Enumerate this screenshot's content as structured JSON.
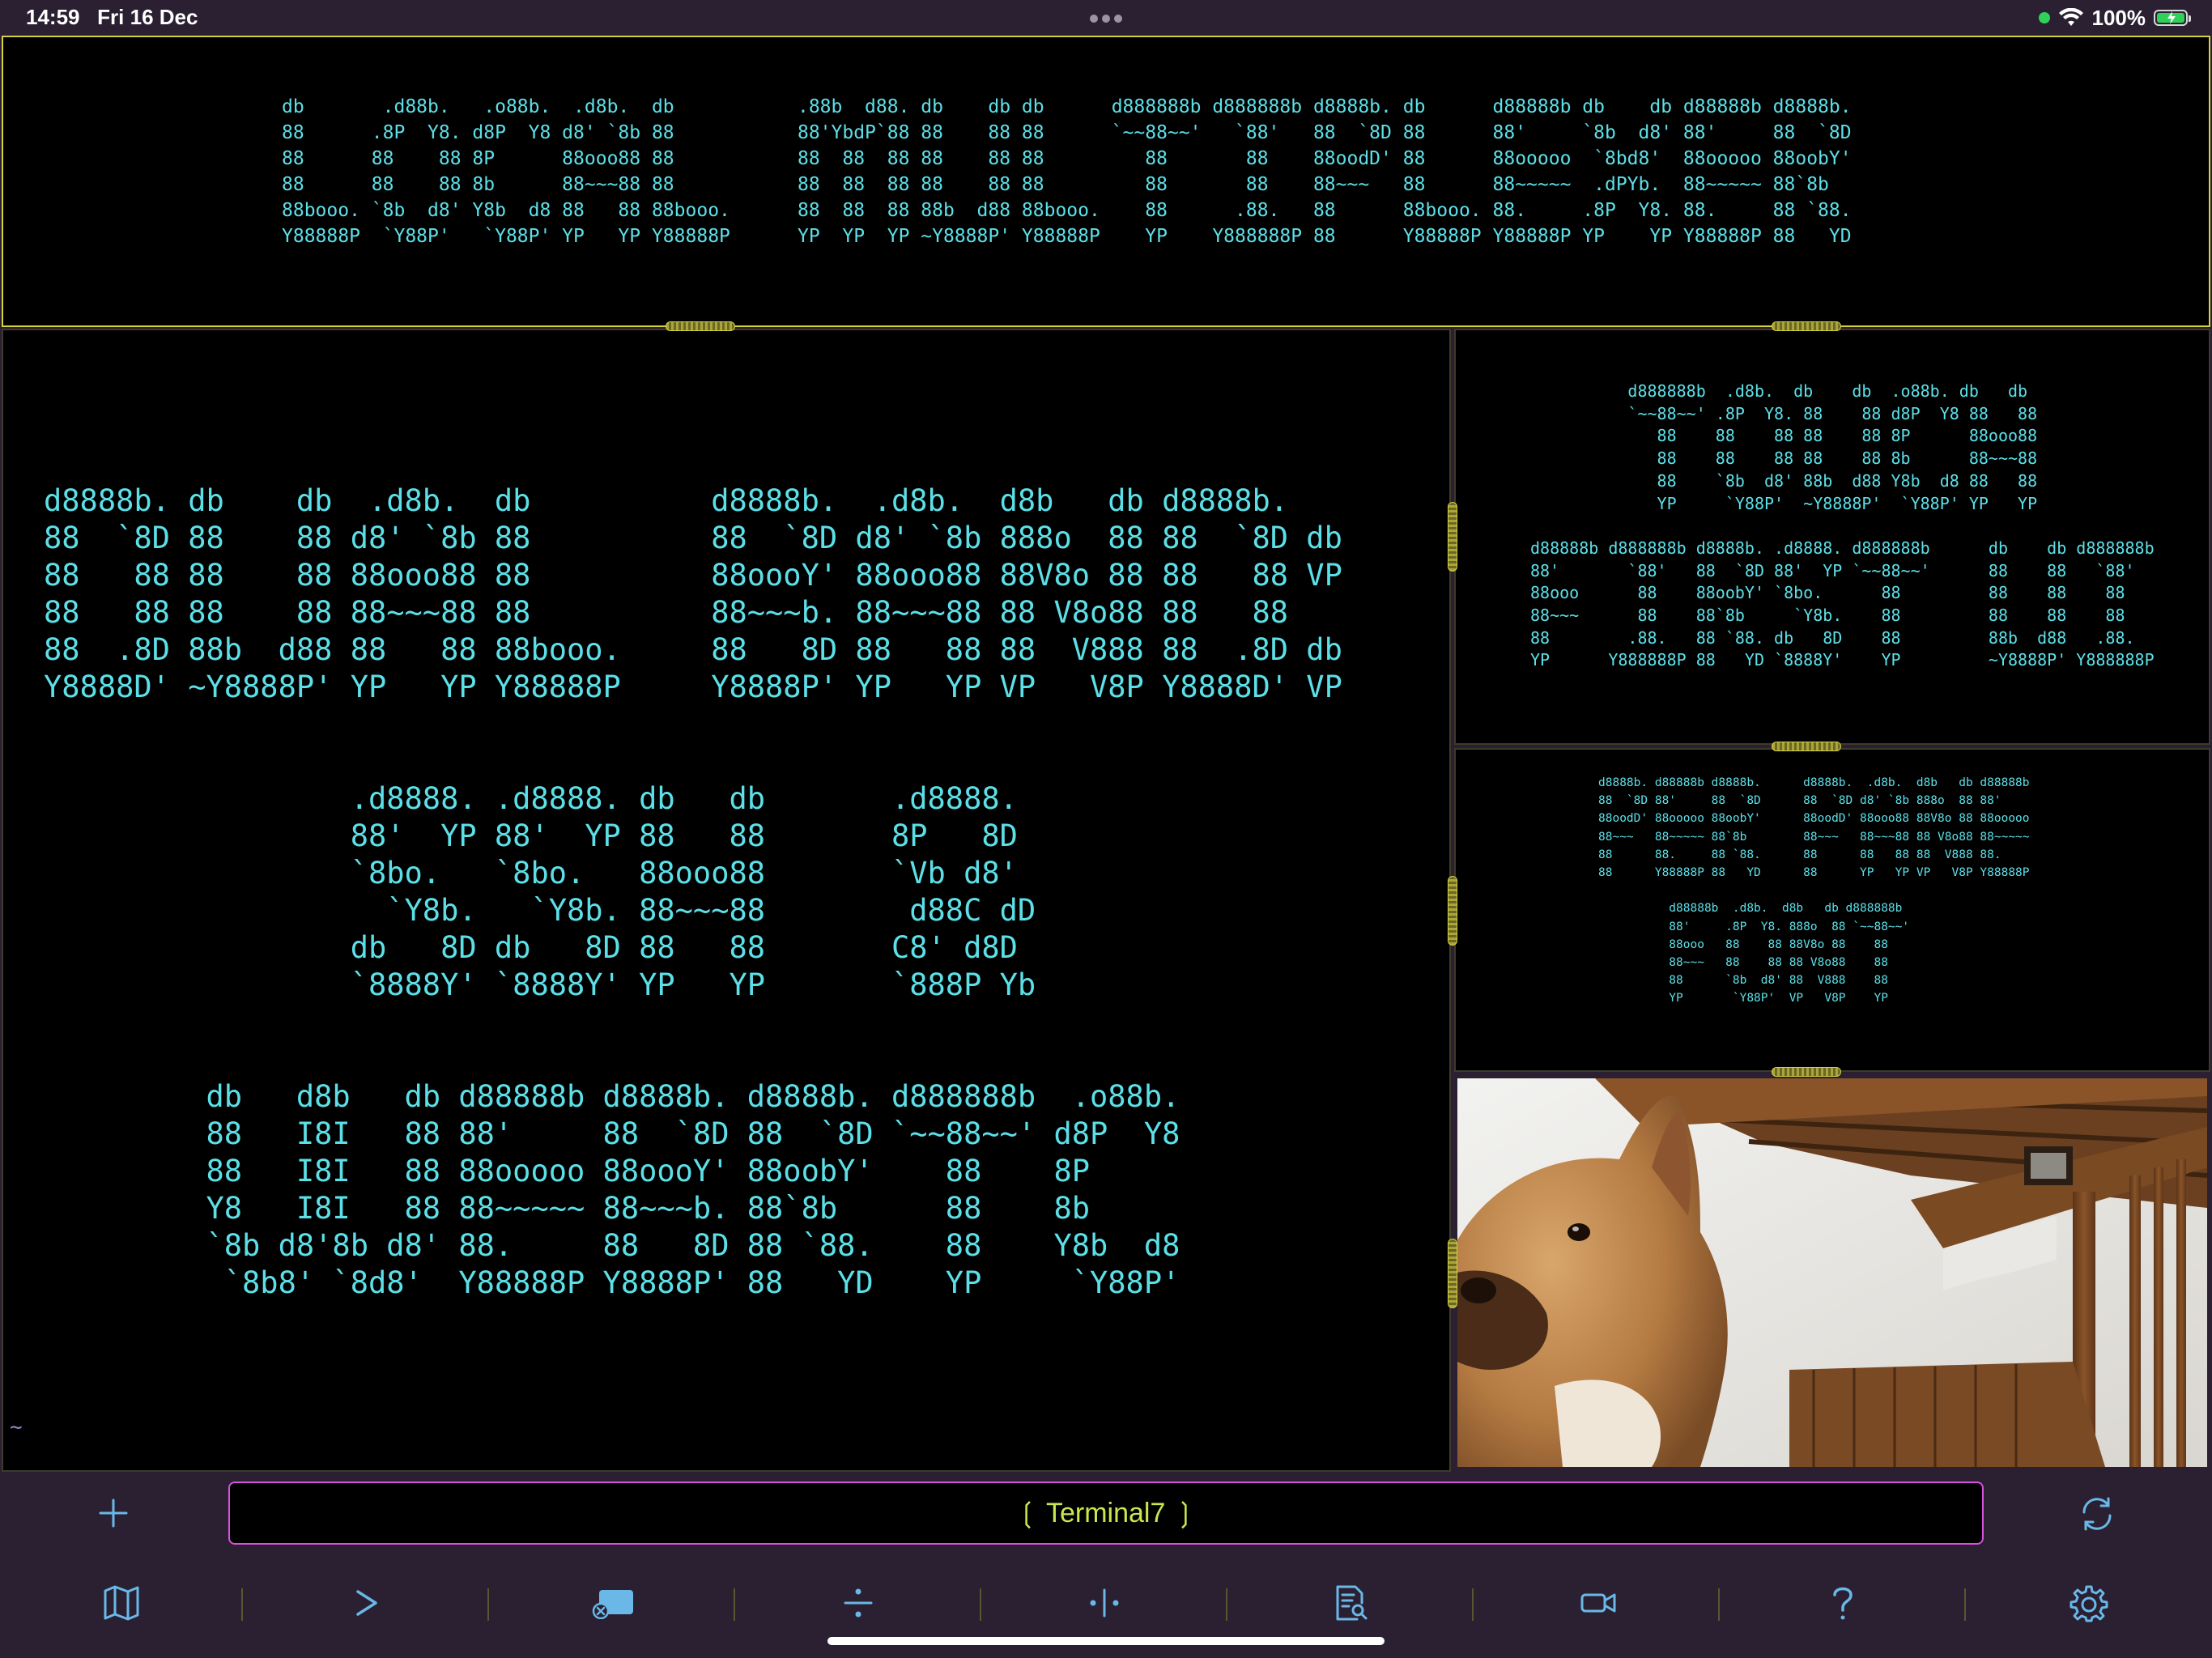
{
  "status_bar": {
    "time": "14:59",
    "date": "Fri 16 Dec",
    "battery_percent": "100%",
    "icons": [
      "green-dot-indicator",
      "wifi-icon",
      "battery-charging-icon"
    ]
  },
  "panes": {
    "top": {
      "ascii": "db       .d88b.   .o88b.  .d8b.  db           .88b  d88. db    db db      d888888b d888888b d8888b. db      d88888b db    db d88888b d8888b.\n88      .8P  Y8. d8P  Y8 d8' `8b 88           88'YbdP`88 88    88 88      `~~88~~'   `88'   88  `8D 88      88'     `8b  d8' 88'     88  `8D\n88      88    88 8P      88ooo88 88           88  88  88 88    88 88         88       88    88oodD' 88      88ooooo  `8bd8'  88ooooo 88oobY'\n88      88    88 8b      88~~~88 88           88  88  88 88    88 88         88       88    88~~~   88      88~~~~~  .dPYb.  88~~~~~ 88`8b\n88booo. `8b  d8' Y8b  d8 88   88 88booo.      88  88  88 88b  d88 88booo.    88      .88.   88      88booo. 88.     .8P  Y8. 88.     88 `88.\nY88888P  `Y88P'   `Y88P' YP   YP Y88888P      YP  YP  YP ~Y8888P' Y88888P    YP    Y888888P 88      Y88888P Y88888P YP    YP Y88888P 88   YD"
    },
    "main": {
      "ascii": "d8888b. db    db  .d8b.  db          d8888b.  .d8b.  d8b   db d8888b.\n88  `8D 88    88 d8' `8b 88          88  `8D d8' `8b 888o  88 88  `8D db\n88   88 88    88 88ooo88 88          88oooY' 88ooo88 88V8o 88 88   88 VP\n88   88 88    88 88~~~88 88          88~~~b. 88~~~88 88 V8o88 88   88\n88  .8D 88b  d88 88   88 88booo.     88   8D 88   88 88  V888 88  .8D db\nY8888D' ~Y8888P' YP   YP Y88888P     Y8888P' YP   YP VP   V8P Y8888D' VP\n\n\n                 .d8888. .d8888. db   db       .d8888.\n                 88'  YP 88'  YP 88   88       8P   8D\n                 `8bo.   `8bo.   88ooo88       `Vb d8'\n                   `Y8b.   `Y8b. 88~~~88        d88C dD\n                 db   8D db   8D 88   88       C8' d8D\n                 `8888Y' `8888Y' YP   YP       `888P Yb\n\n\n         db   d8b   db d88888b d8888b. d8888b. d888888b  .o88b.\n         88   I8I   88 88'     88  `8D 88  `8D `~~88~~' d8P  Y8\n         88   I8I   88 88ooooo 88oooY' 88oobY'    88    8P\n         Y8   I8I   88 88~~~~~ 88~~~b. 88`8b      88    8b\n         `8b d8'8b d8' 88.     88   8D 88 `88.    88    Y8b  d8\n          `8b8' `8d8'  Y88888P Y8888P' 88   YD    YP     `Y88P'",
      "prompt": "~"
    },
    "right_top": {
      "ascii": "          d888888b  .d8b.  db    db  .o88b. db   db\n          `~~88~~' .8P  Y8. 88    88 d8P  Y8 88   88\n             88    88    88 88    88 8P      88ooo88\n             88    88    88 88    88 8b      88~~~88\n             88    `8b  d8' 88b  d88 Y8b  d8 88   88\n             YP     `Y88P'  ~Y8888P'  `Y88P' YP   YP\n\nd88888b d888888b d8888b. .d8888. d888888b      db    db d888888b\n88'       `88'   88  `8D 88'  YP `~~88~~'      88    88   `88'\n88ooo      88    88oobY' `8bo.      88         88    88    88\n88~~~      88    88`8b     `Y8b.    88         88    88    88\n88        .88.   88 `88. db   8D    88         88b  d88   .88.\nYP      Y888888P 88   YD `8888Y'    YP         ~Y8888P' Y888888P"
    },
    "right_mid": {
      "ascii": "d8888b. d88888b d8888b.      d8888b.  .d8b.  d8b   db d88888b\n88  `8D 88'     88  `8D      88  `8D d8' `8b 888o  88 88'\n88oodD' 88ooooo 88oobY'      88oodD' 88ooo88 88V8o 88 88ooooo\n88~~~   88~~~~~ 88`8b        88~~~   88~~~88 88 V8o88 88~~~~~\n88      88.     88 `88.      88      88   88 88  V888 88.\n88      Y88888P 88   YD      88      YP   YP VP   V8P Y88888P\n\n          d88888b  .d8b.  d8b   db d888888b\n          88'     .8P  Y8. 888o  88 `~~88~~'\n          88ooo   88    88 88V8o 88    88\n          88~~~   88    88 88 V8o88    88\n          88      `8b  d8' 88  V888    88\n          YP       `Y88P'  VP   V8P    YP"
    }
  },
  "gate_tab": {
    "title": "❲ Terminal7 ❳"
  },
  "toolbar": {
    "add_icon": "plus-icon",
    "refresh_icon": "refresh-icon",
    "items": [
      "map-icon",
      "prompt-icon",
      "disconnect-icon",
      "split-horizontal-icon",
      "split-vertical-icon",
      "log-icon",
      "video-icon",
      "help-icon",
      "settings-icon"
    ]
  },
  "colors": {
    "ascii": "#5ce0e8",
    "focus_border": "#d6d13c",
    "tab_border": "#d94fe0",
    "tab_title": "#c8e84e",
    "toolbar_icon": "#69b8e8",
    "background": "#2a2031"
  }
}
